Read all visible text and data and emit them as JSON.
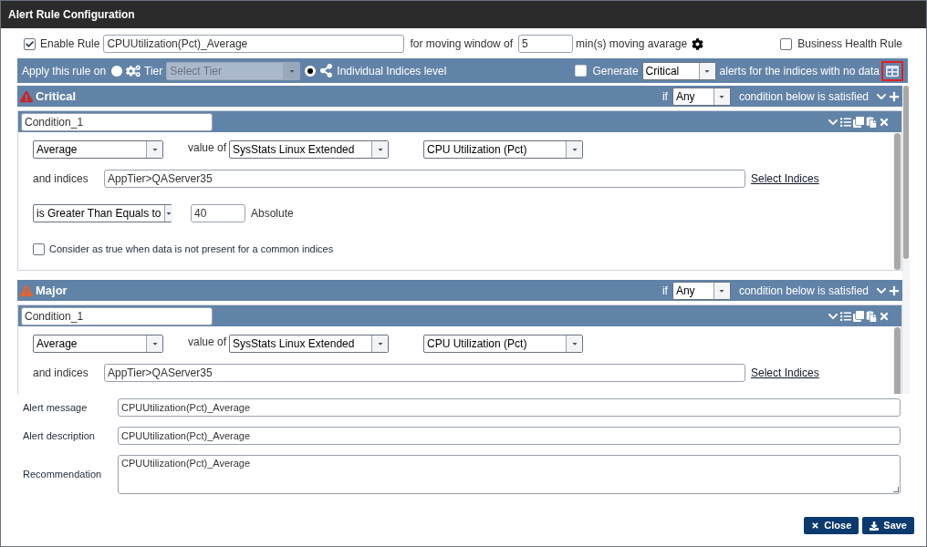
{
  "window": {
    "title": "Alert Rule Configuration"
  },
  "rule": {
    "enabled": true,
    "enable_label": "Enable Rule",
    "name": "CPUUtilization(Pct)_Average",
    "window_label": "for moving window of",
    "window_value": "5",
    "window_unit": "min(s) moving avarage",
    "business_health": {
      "label": "Business Health Rule",
      "checked": false
    }
  },
  "apply_bar": {
    "label": "Apply this rule on",
    "options": [
      {
        "kind": "tier",
        "label": "Tier",
        "selected": false,
        "placeholder": "Select Tier",
        "disabled": true
      },
      {
        "kind": "indices",
        "label": "Individual Indices level",
        "selected": true
      }
    ],
    "generate": {
      "checked": false,
      "label": "Generate",
      "severity": "Critical",
      "suffix": "alerts for the indices with no data"
    }
  },
  "sections": [
    {
      "title": "Critical",
      "color": "#c62828",
      "if_label": "if",
      "match": "Any",
      "match_suffix": "condition below is satisfied",
      "conditions": [
        {
          "name": "Condition_1",
          "function": "Average",
          "value_of_label": "value of",
          "group": "SysStats Linux Extended",
          "metric": "CPU Utilization (Pct)",
          "indices_label": "and indices",
          "indices": "AppTier>QAServer35",
          "select_link": "Select Indices",
          "comparison": {
            "operator": "is Greater Than Equals to",
            "threshold": "40",
            "threshold_type": "Absolute"
          },
          "consider": {
            "label": "Consider as true when data is not present for a common indices",
            "checked": false
          }
        }
      ]
    },
    {
      "title": "Major",
      "color": "#e8622c",
      "if_label": "if",
      "match": "Any",
      "match_suffix": "condition below is satisfied",
      "conditions": [
        {
          "name": "Condition_1",
          "function": "Average",
          "value_of_label": "value of",
          "group": "SysStats Linux Extended",
          "metric": "CPU Utilization (Pct)",
          "indices_label": "and indices",
          "indices": "AppTier>QAServer35",
          "select_link": "Select Indices"
        }
      ]
    }
  ],
  "fields": [
    {
      "kind": "input",
      "label": "Alert message",
      "value": "CPUUtilization(Pct)_Average"
    },
    {
      "kind": "input",
      "label": "Alert description",
      "value": "CPUUtilization(Pct)_Average"
    },
    {
      "kind": "textarea",
      "label": "Recommendation",
      "value": "CPUUtilization(Pct)_Average"
    }
  ],
  "buttons": [
    {
      "kind": "close",
      "label": "Close"
    },
    {
      "kind": "save",
      "label": "Save"
    }
  ]
}
